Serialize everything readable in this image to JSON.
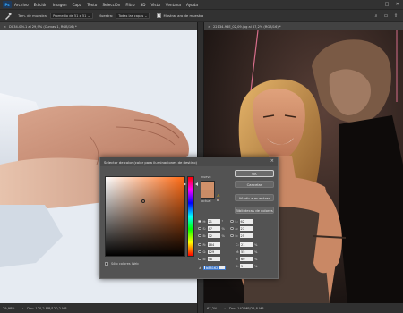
{
  "app": {
    "logo": "Ps"
  },
  "menu": [
    "Archivo",
    "Edición",
    "Imagen",
    "Capa",
    "Texto",
    "Selección",
    "Filtro",
    "3D",
    "Vista",
    "Ventana",
    "Ayuda"
  ],
  "window_controls": [
    "–",
    "□",
    "✕"
  ],
  "options": {
    "sample_size_label": "Tam. de muestra:",
    "sample_size_value": "Promedio de 51 x 51",
    "sample_label": "Muestra:",
    "sample_value": "Todas las capas",
    "show_ring_label": "Mostrar aro de muestra"
  },
  "tabs": {
    "left": "DX34-09i-1 al 29,9% (Curvas 1, RGB/16) *",
    "right": "22134-98E_02,09.jpg al 67,2% (RGB/16) *"
  },
  "status": {
    "left_zoom": "29,98%",
    "left_doc": "Doc: 120,2 MB/120,2 MB",
    "right_zoom": "67,2%",
    "right_doc": "Doc: 142 MB/25,8 MB"
  },
  "dialog": {
    "title": "Selector de color (color para iluminaciones de destino)",
    "new_label": "nuevo",
    "current_label": "actual",
    "ok": "OK",
    "cancel": "Cancelar",
    "add_swatch": "Añadir a muestras",
    "color_libraries": "Bibliotecas de colores",
    "web_only": "Sólo colores Web",
    "fields": {
      "H": {
        "value": "21",
        "unit": "°"
      },
      "S": {
        "value": "47",
        "unit": "%"
      },
      "B": {
        "value": "72",
        "unit": "%"
      },
      "R": {
        "value": "184",
        "unit": ""
      },
      "G": {
        "value": "129",
        "unit": ""
      },
      "Bl": {
        "value": "98",
        "unit": ""
      },
      "L": {
        "value": "62",
        "unit": ""
      },
      "a": {
        "value": "27",
        "unit": ""
      },
      "b": {
        "value": "25",
        "unit": ""
      },
      "C": {
        "value": "21",
        "unit": "%"
      },
      "M": {
        "value": "55",
        "unit": "%"
      },
      "Y": {
        "value": "60",
        "unit": "%"
      },
      "K": {
        "value": "5",
        "unit": "%"
      }
    },
    "hex": "b88162",
    "new_color": "#d1916a",
    "current_color": "#c98c66"
  }
}
